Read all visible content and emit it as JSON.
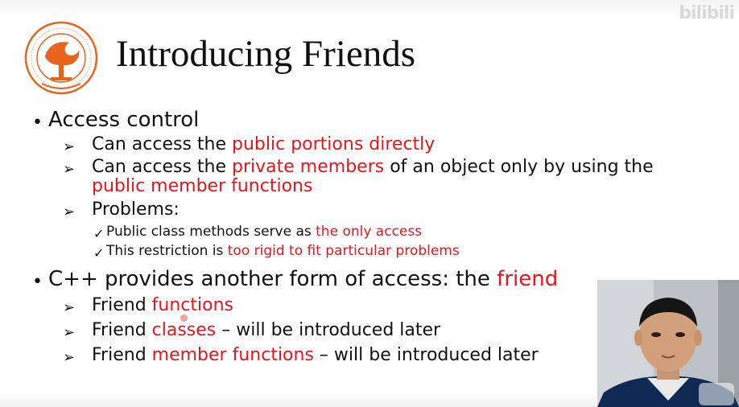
{
  "watermark": "bilibili",
  "slide": {
    "title": "Introducing Friends",
    "items": [
      {
        "text_parts": [
          {
            "t": "Access control",
            "hl": false
          }
        ],
        "subitems": [
          {
            "parts": [
              {
                "t": "Can access the ",
                "hl": false
              },
              {
                "t": "public portions directly",
                "hl": true
              }
            ]
          },
          {
            "parts": [
              {
                "t": "Can access the ",
                "hl": false
              },
              {
                "t": "private members",
                "hl": true
              },
              {
                "t": " of an object only by using the",
                "hl": false
              }
            ],
            "continuation": [
              {
                "t": "public member functions",
                "hl": true
              }
            ]
          },
          {
            "parts": [
              {
                "t": "Problems:",
                "hl": false
              }
            ],
            "checks": [
              [
                {
                  "t": "Public class methods serve as ",
                  "hl": false
                },
                {
                  "t": "the only access",
                  "hl": true
                }
              ],
              [
                {
                  "t": "This restriction is ",
                  "hl": false
                },
                {
                  "t": "too rigid to fit particular problems",
                  "hl": true
                }
              ]
            ]
          }
        ]
      },
      {
        "text_parts": [
          {
            "t": "C++ provides another form of access: the ",
            "hl": false
          },
          {
            "t": "friend",
            "hl": true
          }
        ],
        "subitems": [
          {
            "parts": [
              {
                "t": "Friend ",
                "hl": false
              },
              {
                "t": "functions",
                "hl": true
              }
            ]
          },
          {
            "parts": [
              {
                "t": "Friend ",
                "hl": false
              },
              {
                "t": "classes",
                "hl": true
              },
              {
                "t": " – will be introduced later",
                "hl": false
              }
            ]
          },
          {
            "parts": [
              {
                "t": "Friend ",
                "hl": false
              },
              {
                "t": "member functions",
                "hl": true
              },
              {
                "t": " – will be introduced later",
                "hl": false
              }
            ]
          }
        ]
      }
    ]
  },
  "colors": {
    "highlight": "#e8141b",
    "logo": "#e8641c",
    "text": "#111111"
  },
  "icons": {
    "bullet": "bullet-dot",
    "sub": "arrowhead-icon",
    "check": "checkmark-icon",
    "logo": "university-logo-icon"
  }
}
